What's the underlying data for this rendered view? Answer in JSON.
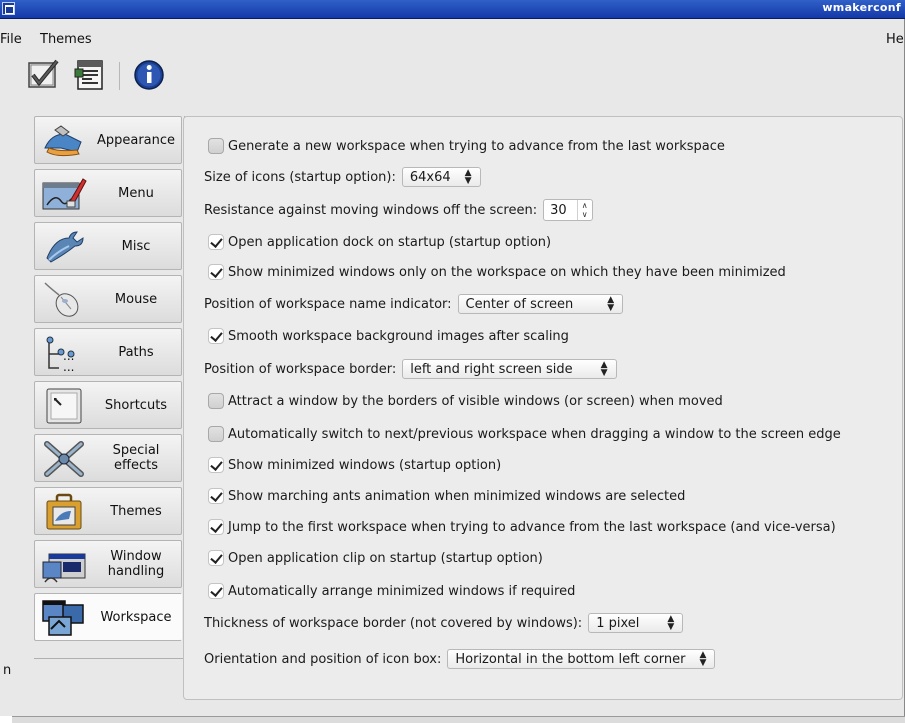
{
  "window": {
    "title": "wmakerconf"
  },
  "menubar": {
    "file": "File",
    "themes": "Themes",
    "help": "Hel"
  },
  "toolbar": [
    {
      "name": "apply-button",
      "icon": "check-icon"
    },
    {
      "name": "save-button",
      "icon": "document-icon"
    },
    {
      "name": "info-button",
      "icon": "info-icon"
    }
  ],
  "sidebar": {
    "items": [
      {
        "label": "Appearance",
        "icon": "appearance-icon"
      },
      {
        "label": "Menu",
        "icon": "menu-icon"
      },
      {
        "label": "Misc",
        "icon": "wrench-icon"
      },
      {
        "label": "Mouse",
        "icon": "mouse-icon"
      },
      {
        "label": "Paths",
        "icon": "paths-icon"
      },
      {
        "label": "Shortcuts",
        "icon": "keyboard-key-icon"
      },
      {
        "label": "Special effects",
        "icon": "special-effects-icon"
      },
      {
        "label": "Themes",
        "icon": "suitcase-icon"
      },
      {
        "label": "Window handling",
        "icon": "window-handling-icon"
      },
      {
        "label": "Workspace",
        "icon": "workspace-icon"
      }
    ],
    "active": "Workspace"
  },
  "options": [
    {
      "type": "checkbox",
      "checked": false,
      "label": "Generate a new workspace when trying to advance from the last workspace"
    },
    {
      "type": "select",
      "label": "Size of icons (startup option):",
      "value": "64x64"
    },
    {
      "type": "spin",
      "label": "Resistance against moving windows off the screen:",
      "value": "30"
    },
    {
      "type": "checkbox",
      "checked": true,
      "label": "Open application dock on startup (startup option)"
    },
    {
      "type": "checkbox",
      "checked": true,
      "label": "Show minimized windows only on the workspace on which they have been minimized"
    },
    {
      "type": "select",
      "label": "Position of workspace name indicator:",
      "value": "Center of screen"
    },
    {
      "type": "checkbox",
      "checked": true,
      "label": "Smooth workspace background images after scaling"
    },
    {
      "type": "select",
      "label": "Position of workspace border:",
      "value": "left and right screen side"
    },
    {
      "type": "checkbox",
      "checked": false,
      "label": "Attract a window by the borders of visible windows (or screen) when moved"
    },
    {
      "type": "checkbox",
      "checked": false,
      "label": "Automatically switch to next/previous workspace when dragging a window to the screen edge"
    },
    {
      "type": "checkbox",
      "checked": true,
      "label": "Show minimized windows (startup option)"
    },
    {
      "type": "checkbox",
      "checked": true,
      "label": "Show marching ants animation when minimized windows are selected"
    },
    {
      "type": "checkbox",
      "checked": true,
      "label": "Jump to the first workspace when trying to advance from the last workspace (and vice-versa)"
    },
    {
      "type": "checkbox",
      "checked": true,
      "label": "Open application clip on startup (startup option)"
    },
    {
      "type": "checkbox",
      "checked": true,
      "label": "Automatically arrange minimized windows if required"
    },
    {
      "type": "select",
      "label": "Thickness of workspace border (not covered by windows):",
      "value": "1 pixel"
    },
    {
      "type": "select",
      "label": "Orientation and position of icon box:",
      "value": "Horizontal in the bottom left corner"
    }
  ],
  "edge_text": "n"
}
